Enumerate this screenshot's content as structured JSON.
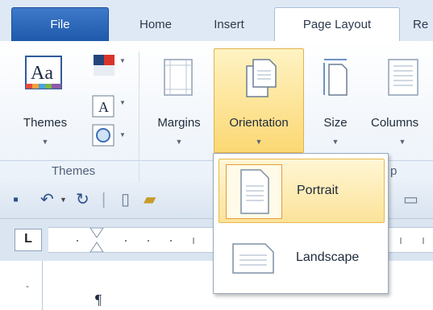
{
  "tabs": {
    "file": "File",
    "home": "Home",
    "insert": "Insert",
    "page_layout": "Page Layout",
    "cut": "Re"
  },
  "ribbon": {
    "themes": {
      "label": "Themes",
      "icon_text": "Aa",
      "font_text": "A"
    },
    "margins": {
      "label": "Margins"
    },
    "orientation": {
      "label": "Orientation"
    },
    "size": {
      "label": "Size"
    },
    "columns": {
      "label": "Columns"
    },
    "group_themes": "Themes",
    "group_page_setup_fragment": "p"
  },
  "dropdown": {
    "portrait": "Portrait",
    "landscape": "Landscape"
  },
  "ruler": {
    "tabstop_glyph": "L"
  },
  "document": {
    "pilcrow": "¶"
  },
  "colors": {
    "accent_file": "#2a62b8",
    "highlight": "#fbd873",
    "ribbon_bg": "#eaf1f9"
  }
}
